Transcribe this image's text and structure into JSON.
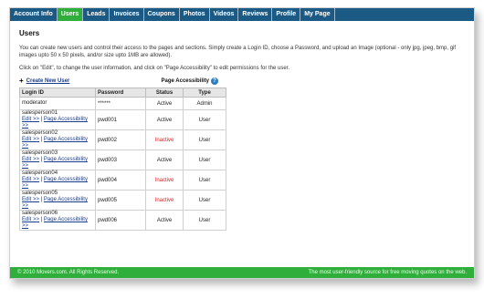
{
  "nav": {
    "items": [
      {
        "label": "Account Info",
        "active": false
      },
      {
        "label": "Users",
        "active": true
      },
      {
        "label": "Leads",
        "active": false
      },
      {
        "label": "Invoices",
        "active": false
      },
      {
        "label": "Coupons",
        "active": false
      },
      {
        "label": "Photos",
        "active": false
      },
      {
        "label": "Videos",
        "active": false
      },
      {
        "label": "Reviews",
        "active": false
      },
      {
        "label": "Profile",
        "active": false
      },
      {
        "label": "My Page",
        "active": false
      }
    ]
  },
  "page": {
    "title": "Users",
    "intro": "You can create new users and control their access to the pages and sections. Simply create a Login ID, choose a Password, and upload an Image (optional - only jpg, jpeg, bmp, gif images upto 50 x 50 pixels, and/or size upto 1MB are allowed).",
    "instruction": "Click on \"Edit\", to change the user information, and click on \"Page Accessibility\" to edit permissions for the user.",
    "create_new_user": "Create New User",
    "page_accessibility_label": "Page Accessibility",
    "help_icon": "?"
  },
  "table": {
    "headers": {
      "login": "Login ID",
      "password": "Password",
      "status": "Status",
      "type": "Type"
    },
    "edit_link": "Edit >>",
    "separator": " | ",
    "pa_link": "Page Accessibility >>",
    "rows": [
      {
        "login": "moderator",
        "password": "******",
        "status": "Active",
        "type": "Admin",
        "links": false
      },
      {
        "login": "salesperson01",
        "password": "pwd001",
        "status": "Active",
        "type": "User",
        "links": true
      },
      {
        "login": "salesperson02",
        "password": "pwd002",
        "status": "Inactive",
        "type": "User",
        "links": true
      },
      {
        "login": "salesperson03",
        "password": "pwd003",
        "status": "Active",
        "type": "User",
        "links": true
      },
      {
        "login": "salesperson04",
        "password": "pwd004",
        "status": "Inactive",
        "type": "User",
        "links": true
      },
      {
        "login": "salesperson05",
        "password": "pwd005",
        "status": "Inactive",
        "type": "User",
        "links": true
      },
      {
        "login": "salesperson06",
        "password": "pwd006",
        "status": "Active",
        "type": "User",
        "links": true
      }
    ]
  },
  "footer": {
    "copyright": "© 2010 Movers.com. All Rights Reserved.",
    "tagline": "The most user-friendly source for free moving quotes on the web."
  },
  "colors": {
    "nav_bg": "#1c5a86",
    "active_tab": "#2fae3b",
    "footer_bg": "#2fae3b",
    "inactive_status": "#e02020",
    "link": "#1a3c8c"
  }
}
